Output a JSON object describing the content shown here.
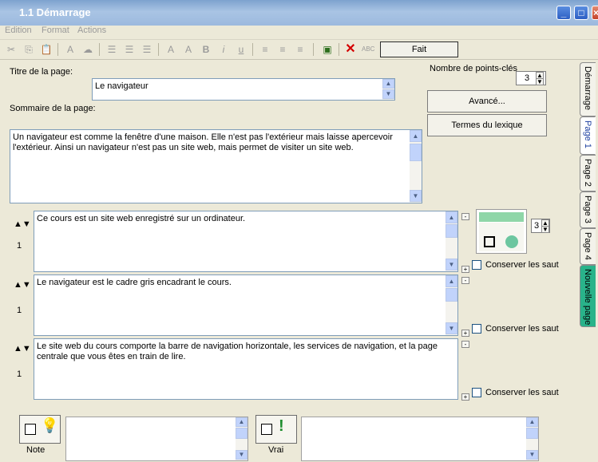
{
  "window": {
    "title": "1.1 Démarrage"
  },
  "menu": [
    "Edition",
    "Format",
    "Actions"
  ],
  "toolbar": {
    "fait_label": "Fait"
  },
  "titre": {
    "label": "Titre de la page:",
    "value": "Le navigateur"
  },
  "sommaire": {
    "label": "Sommaire de la page:",
    "value": "Un navigateur est comme la fenêtre d'une maison. Elle n'est pas l'extérieur mais laisse apercevoir l'extérieur. Ainsi un navigateur n'est pas un site web, mais permet de visiter un site web."
  },
  "points": {
    "label": "Nombre de points-clés",
    "value": "3"
  },
  "buttons": {
    "avance": "Avancé...",
    "lexique": "Termes du lexique"
  },
  "points_list": [
    {
      "num": "1",
      "text": "Ce cours est un site web enregistré sur un ordinateur.",
      "conserver": "Conserver les saut"
    },
    {
      "num": "1",
      "text": "Le navigateur est le cadre gris encadrant le cours.",
      "conserver": "Conserver les saut"
    },
    {
      "num": "1",
      "text": "Le site web du cours comporte la barre de navigation horizontale, les services de navigation, et la page centrale que vous êtes en train de lire.",
      "conserver": "Conserver les saut"
    }
  ],
  "image_spinner": "3",
  "tabs": [
    "Démarrage",
    "Page 1",
    "Page 2",
    "Page 3",
    "Page 4",
    "Nouvelle page"
  ],
  "bottom": {
    "note_label": "Note",
    "vrai_label": "Vrai"
  }
}
